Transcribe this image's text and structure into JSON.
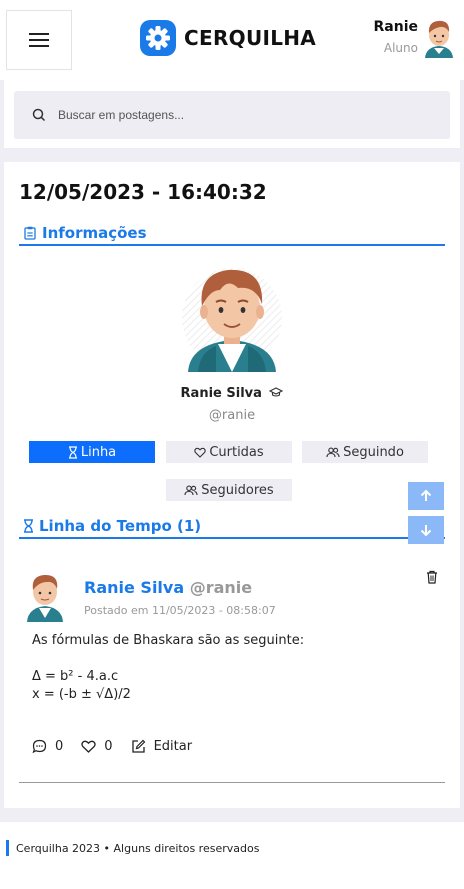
{
  "header": {
    "brand": "CERQUILHA",
    "user_name": "Ranie",
    "user_role": "Aluno"
  },
  "search": {
    "placeholder": "Buscar em postagens..."
  },
  "main": {
    "datetime": "12/05/2023 - 16:40:32",
    "info_title": "Informações",
    "profile_name": "Ranie Silva",
    "profile_handle": "@ranie",
    "tabs": {
      "timeline": "Linha",
      "liked": "Curtidas",
      "following": "Seguindo",
      "followers": "Seguidores"
    },
    "timeline_title": "Linha do Tempo (1)"
  },
  "post": {
    "author": "Ranie Silva",
    "handle": "@ranie",
    "date": "Postado em 11/05/2023 - 08:58:07",
    "lines": [
      "As fórmulas de Bhaskara são as seguinte:",
      "",
      "Δ = b² - 4.a.c",
      "x = (-b ± √Δ)/2"
    ],
    "comments": "0",
    "likes": "0",
    "edit_label": "Editar"
  },
  "footer": {
    "text": "Cerquilha 2023 • Alguns direitos reservados"
  },
  "colors": {
    "accent": "#1a7ae8",
    "active_tab": "#0d6efd",
    "scroll_button": "#8bb8f7"
  },
  "icons": [
    "menu-icon",
    "gear-logo-icon",
    "search-icon",
    "clipboard-icon",
    "graduation-cap-icon",
    "hourglass-icon",
    "heart-icon",
    "users-icon",
    "arrow-up-icon",
    "arrow-down-icon",
    "trash-icon",
    "comment-icon",
    "edit-icon"
  ]
}
